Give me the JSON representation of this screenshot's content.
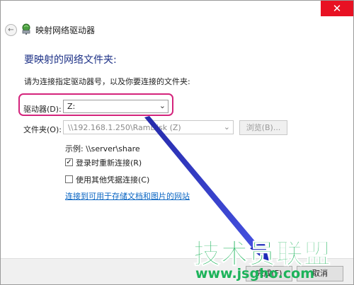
{
  "window": {
    "close_glyph": "✕"
  },
  "header": {
    "back_glyph": "←",
    "title": "映射网络驱动器"
  },
  "main": {
    "heading": "要映射的网络文件夹:",
    "instruction": "请为连接指定驱动器号，以及你要连接的文件夹:",
    "drive_label": "驱动器(D):",
    "drive_value": "Z:",
    "folder_label": "文件夹(O):",
    "folder_value": "\\\\192.168.1.250\\RamDisk (Z)",
    "browse_label": "浏览(B)...",
    "example_text": "示例: \\\\server\\share",
    "reconnect_label": "登录时重新连接(R)",
    "reconnect_checked": true,
    "other_creds_label": "使用其他凭据连接(C)",
    "other_creds_checked": false,
    "link_text": "连接到可用于存储文档和图片的网站"
  },
  "footer": {
    "finish_label": "完成(F)",
    "cancel_label": "取消"
  },
  "watermark": {
    "logo_text": "技术员联盟",
    "url_text": "www.jsgho.com"
  },
  "colors": {
    "heading": "#1e3287",
    "highlight": "#d4247c",
    "arrow": "#2b35c8",
    "link": "#0b66c3",
    "close": "#e81123",
    "watermark": "#1cb35a"
  },
  "icons": {
    "back": "back-arrow-icon",
    "drive": "network-drive-icon",
    "close": "close-icon",
    "chevron": "chevron-down-icon",
    "checkmark": "checkmark-icon"
  }
}
